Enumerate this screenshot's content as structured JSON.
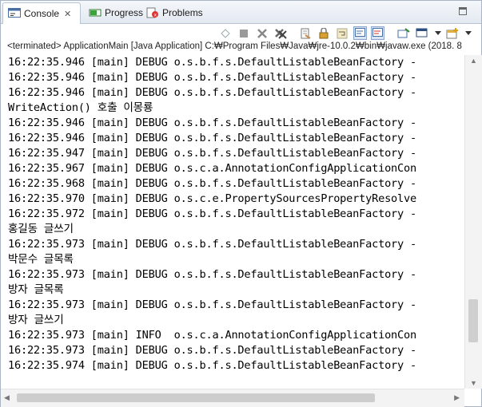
{
  "tabs": {
    "console": "Console",
    "console_close": "✕",
    "progress": "Progress",
    "problems": "Problems"
  },
  "status": "<terminated> ApplicationMain [Java Application] C:₩Program Files₩Java₩jre-10.0.2₩bin₩javaw.exe (2018. 8",
  "lines": [
    "16:22:35.946 [main] DEBUG o.s.b.f.s.DefaultListableBeanFactory -",
    "16:22:35.946 [main] DEBUG o.s.b.f.s.DefaultListableBeanFactory -",
    "16:22:35.946 [main] DEBUG o.s.b.f.s.DefaultListableBeanFactory -",
    "WriteAction() 호출 이몽룡",
    "16:22:35.946 [main] DEBUG o.s.b.f.s.DefaultListableBeanFactory -",
    "16:22:35.946 [main] DEBUG o.s.b.f.s.DefaultListableBeanFactory -",
    "16:22:35.947 [main] DEBUG o.s.b.f.s.DefaultListableBeanFactory -",
    "16:22:35.967 [main] DEBUG o.s.c.a.AnnotationConfigApplicationCon",
    "16:22:35.968 [main] DEBUG o.s.b.f.s.DefaultListableBeanFactory -",
    "16:22:35.970 [main] DEBUG o.s.c.e.PropertySourcesPropertyResolve",
    "16:22:35.972 [main] DEBUG o.s.b.f.s.DefaultListableBeanFactory -",
    "홍길동 글쓰기",
    "16:22:35.973 [main] DEBUG o.s.b.f.s.DefaultListableBeanFactory -",
    "박문수 글목록",
    "16:22:35.973 [main] DEBUG o.s.b.f.s.DefaultListableBeanFactory -",
    "방자 글목록",
    "16:22:35.973 [main] DEBUG o.s.b.f.s.DefaultListableBeanFactory -",
    "방자 글쓰기",
    "16:22:35.973 [main] INFO  o.s.c.a.AnnotationConfigApplicationCon",
    "16:22:35.973 [main] DEBUG o.s.b.f.s.DefaultListableBeanFactory -",
    "16:22:35.974 [main] DEBUG o.s.b.f.s.DefaultListableBeanFactory -"
  ],
  "toolbar_icons": [
    "remove-all-terminated-icon",
    "terminate-icon",
    "remove-launch-icon",
    "remove-all-icon",
    "clear-console-icon",
    "scroll-lock-icon",
    "word-wrap-icon",
    "show-on-stdout-icon",
    "show-on-stderr-icon",
    "pin-console-icon",
    "display-console-icon",
    "open-console-icon"
  ],
  "scroll": {
    "vertical_position": 0.9,
    "horizontal_position": 0.0
  }
}
